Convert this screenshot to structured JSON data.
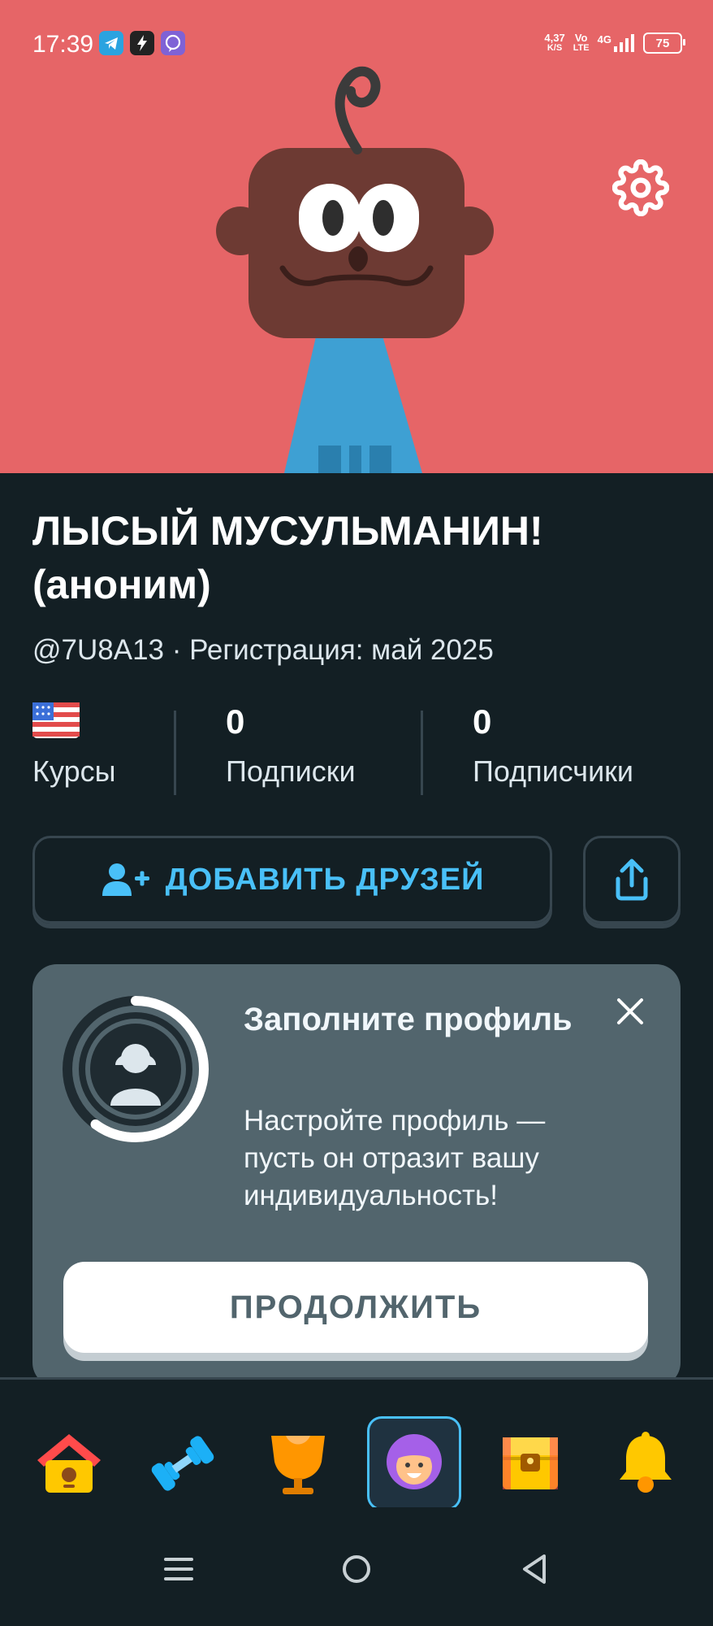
{
  "status_bar": {
    "time": "17:39",
    "speed_top": "4,37",
    "speed_bottom": "K/S",
    "volte_top": "Vo",
    "volte_bottom": "LTE",
    "network": "4G",
    "battery": "75",
    "app_icons": [
      "telegram-icon",
      "flash-app-icon",
      "viber-icon"
    ]
  },
  "profile": {
    "display_name": "ЛЫСЫЙ МУСУЛЬМАНИН! (аноним)",
    "meta": "@7U8A13 · Регистрация: май 2025",
    "stats": {
      "courses_label": "Курсы",
      "following_value": "0",
      "following_label": "Подписки",
      "followers_value": "0",
      "followers_label": "Подписчики"
    },
    "add_friends_label": "ДОБАВИТЬ ДРУЗЕЙ"
  },
  "complete_card": {
    "title": "Заполните профиль",
    "text": "Настройте профиль — пусть он отразит вашу индивидуальность!",
    "continue_label": "ПРОДОЛЖИТЬ",
    "progress": 0.6
  },
  "bottom_nav": {
    "items": [
      "home-icon",
      "practice-icon",
      "leaderboard-icon",
      "profile-icon",
      "shop-icon",
      "notifications-icon"
    ],
    "active": "profile-icon"
  },
  "colors": {
    "hero_bg": "#e66567",
    "page_bg": "#131f24",
    "accent_blue": "#49c0f8",
    "card_bg": "#52656d",
    "border": "#37464f"
  }
}
